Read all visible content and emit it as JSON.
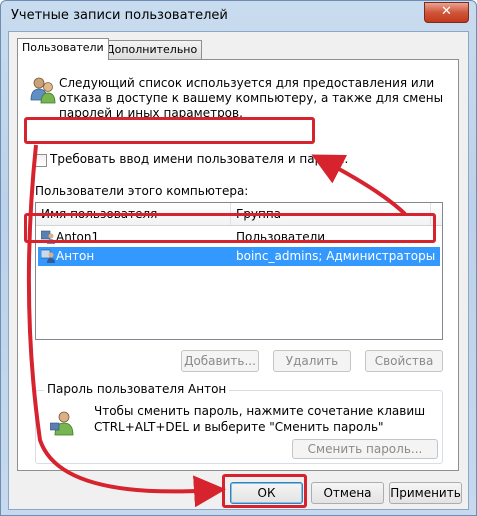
{
  "window": {
    "title": "Учетные записи пользователей",
    "close_glyph": "✕"
  },
  "tabs": [
    {
      "label": "Пользователи",
      "active": true
    },
    {
      "label": "Дополнительно",
      "active": false
    }
  ],
  "info_text": "Следующий список используется для предоставления или отказа в доступе к вашему компьютеру, а также для смены паролей и иных параметров.",
  "require_login": {
    "label": "Требовать ввод имени пользователя и пароля.",
    "checked": false
  },
  "users_section_label": "Пользователи этого компьютера:",
  "users_table": {
    "columns": [
      "Имя пользователя",
      "Группа"
    ],
    "rows": [
      {
        "name": "Anton1",
        "group": "Пользователи",
        "selected": false
      },
      {
        "name": "Антон",
        "group": "boinc_admins; Администраторы",
        "selected": true
      }
    ]
  },
  "list_buttons": {
    "add": "Добавить...",
    "remove": "Удалить",
    "properties": "Свойства"
  },
  "password_group": {
    "title": "Пароль пользователя Антон",
    "text": "Чтобы сменить пароль, нажмите сочетание клавиш CTRL+ALT+DEL и выберите \"Сменить пароль\"",
    "button": "Сменить пароль..."
  },
  "dialog_buttons": {
    "ok": "ОК",
    "cancel": "Отмена",
    "apply": "Применить"
  },
  "colors": {
    "annotation_red": "#d6232e",
    "selection": "#3399ff"
  },
  "icons": [
    "users-icon",
    "user-icon",
    "user-key-icon",
    "close-icon"
  ]
}
